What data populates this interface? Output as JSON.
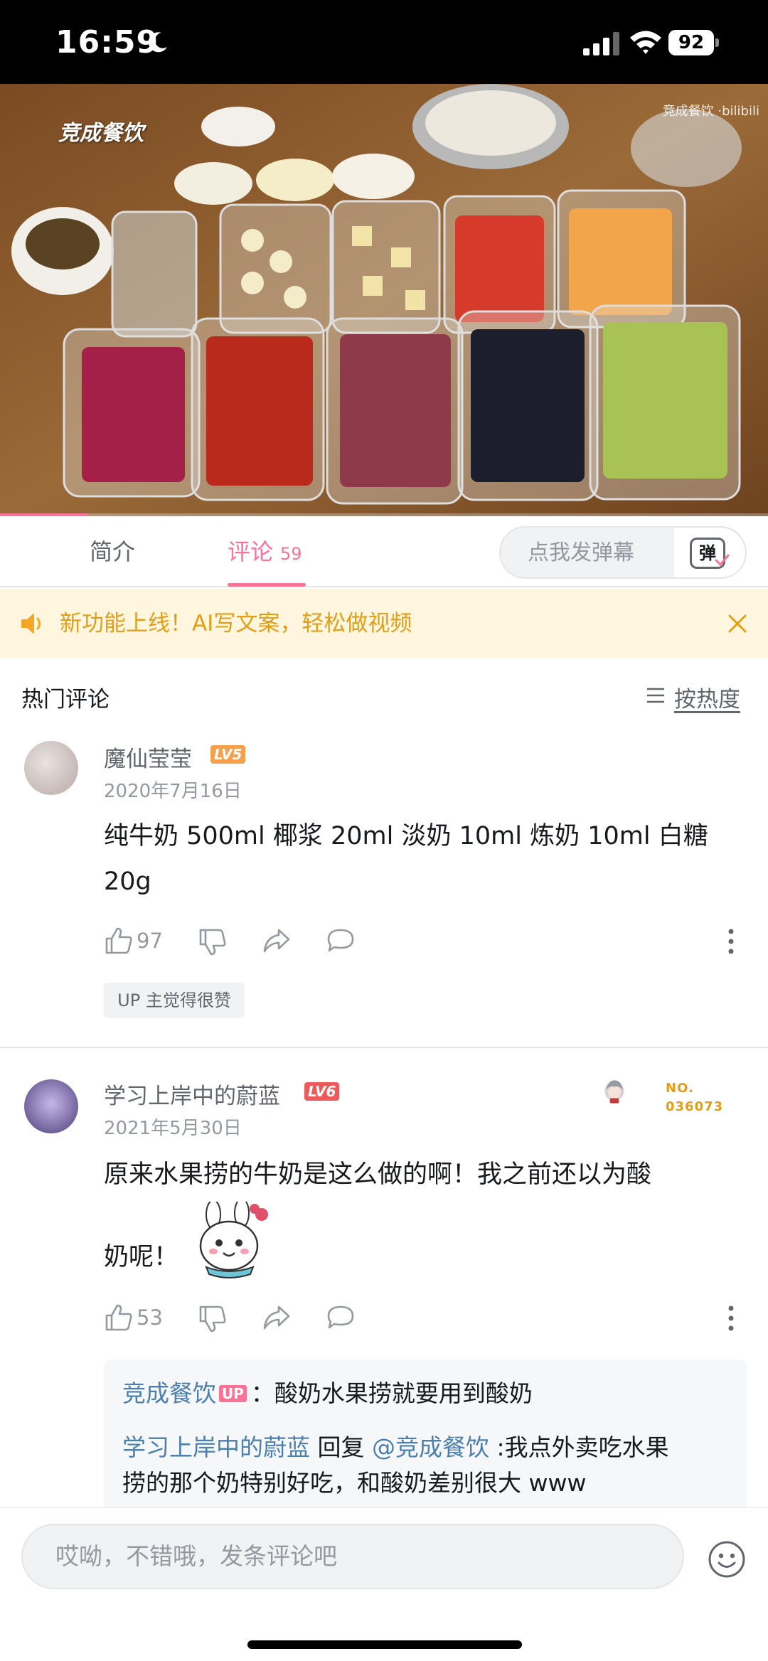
{
  "status_bar": {
    "time": "16:59",
    "battery": "92"
  },
  "video": {
    "watermark": "竞成餐饮",
    "corner_logo": "竞成餐饮 ·bilibili",
    "progress_fraction": 0.114
  },
  "tabs": {
    "intro": "简介",
    "comments": "评论",
    "comment_count": "59"
  },
  "danmaku": {
    "placeholder": "点我发弹幕",
    "button": "弹"
  },
  "notice": {
    "text": "新功能上线！AI写文案，轻松做视频"
  },
  "hot": {
    "title": "热门评论",
    "sort_label": "按热度"
  },
  "comments": [
    {
      "username": "魔仙莹莹",
      "level": "LV5",
      "date": "2020年7月16日",
      "text": "纯牛奶 500ml 椰浆 20ml 淡奶 10ml 炼奶 10ml 白糖 20g",
      "likes": "97",
      "tag": "UP 主觉得很赞"
    },
    {
      "username": "学习上岸中的蔚蓝",
      "level": "LV6",
      "date": "2021年5月30日",
      "text_line1": "原来水果捞的牛奶是这么做的啊！我之前还以为酸",
      "text_line2": "奶呢！",
      "likes": "53",
      "fan_badge": {
        "no_label": "NO.",
        "number": "036073"
      },
      "replies": [
        {
          "name": "竞成餐饮",
          "badge": "UP",
          "text": "：酸奶水果捞就要用到酸奶"
        },
        {
          "name": "学习上岸中的蔚蓝",
          "reply_word": " 回复 ",
          "target": "@竞成餐饮",
          "text_line1": " :我点外卖吃水果",
          "text_line2": "捞的那个奶特别好吃，和酸奶差别很大 www"
        }
      ]
    }
  ],
  "input": {
    "placeholder": "哎呦，不错哦，发条评论吧"
  },
  "colors": {
    "accent": "#fb7299",
    "notice_bg": "#fff6e0",
    "notice_text": "#e39e16",
    "link": "#4a7fae",
    "lv5": "#f6a04d",
    "lv6": "#ee5a5a"
  }
}
